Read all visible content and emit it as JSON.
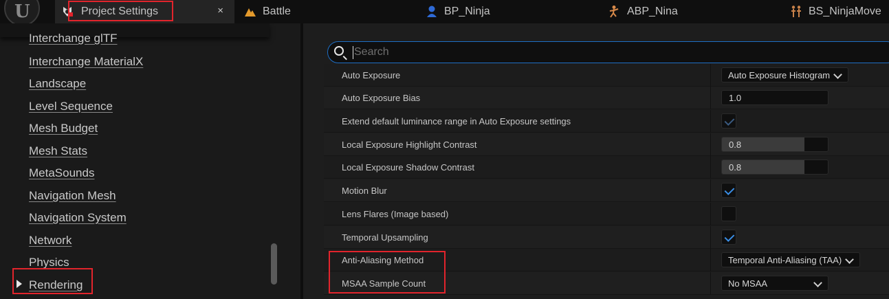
{
  "tabs": [
    {
      "label": "Project Settings",
      "icon": "gear-icon",
      "active": true
    },
    {
      "label": "Battle",
      "icon": "level-icon",
      "active": false
    },
    {
      "label": "BP_Ninja",
      "icon": "blueprint-character-icon",
      "active": false
    },
    {
      "label": "ABP_Nina",
      "icon": "animation-blueprint-icon",
      "active": false
    },
    {
      "label": "BS_NinjaMove",
      "icon": "blend-space-icon",
      "active": false
    }
  ],
  "tab_close": "×",
  "engine_logo": "U",
  "sidebar": {
    "items": [
      {
        "label": "Interchange glTF"
      },
      {
        "label": "Interchange MaterialX"
      },
      {
        "label": "Landscape"
      },
      {
        "label": "Level Sequence"
      },
      {
        "label": "Mesh Budget"
      },
      {
        "label": "Mesh Stats"
      },
      {
        "label": "MetaSounds"
      },
      {
        "label": "Navigation Mesh"
      },
      {
        "label": "Navigation System"
      },
      {
        "label": "Network"
      },
      {
        "label": "Physics"
      },
      {
        "label": "Rendering",
        "selected": true
      }
    ]
  },
  "search": {
    "placeholder": "Search"
  },
  "settings": [
    {
      "label": "Auto Exposure",
      "type": "combo",
      "value": "Auto Exposure Histogram"
    },
    {
      "label": "Auto Exposure Bias",
      "type": "number",
      "value": "1.0"
    },
    {
      "label": "Extend default luminance range in Auto Exposure settings",
      "type": "checkbox",
      "checked": true,
      "disabled": true
    },
    {
      "label": "Local Exposure Highlight Contrast",
      "type": "slider",
      "value": "0.8",
      "fraction": 0.8
    },
    {
      "label": "Local Exposure Shadow Contrast",
      "type": "slider",
      "value": "0.8",
      "fraction": 0.8
    },
    {
      "label": "Motion Blur",
      "type": "checkbox",
      "checked": true
    },
    {
      "label": "Lens Flares (Image based)",
      "type": "checkbox",
      "checked": false
    },
    {
      "label": "Temporal Upsampling",
      "type": "checkbox",
      "checked": true
    },
    {
      "label": "Anti-Aliasing Method",
      "type": "combo",
      "value": "Temporal Anti-Aliasing (TAA)"
    },
    {
      "label": "MSAA Sample Count",
      "type": "combo",
      "value": "No MSAA"
    }
  ],
  "colors": {
    "accent": "#3a8ee6",
    "highlight": "#e2242c"
  }
}
